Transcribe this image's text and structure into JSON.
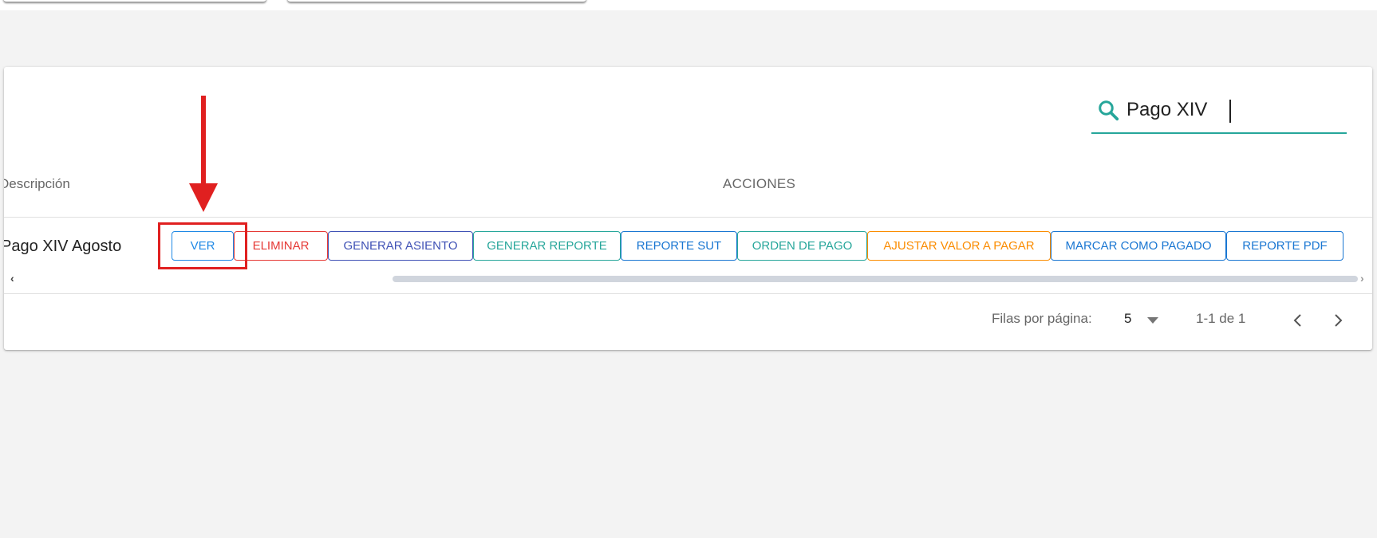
{
  "search": {
    "value": "Pago XIV",
    "icon": "search-icon"
  },
  "table": {
    "headers": {
      "description": "Descripción",
      "actions": "ACCIONES"
    },
    "rows": [
      {
        "description": "Pago XIV Agosto"
      }
    ]
  },
  "actions": [
    {
      "label": "VER",
      "color": "#1e88e5"
    },
    {
      "label": "ELIMINAR",
      "color": "#e53935"
    },
    {
      "label": "GENERAR ASIENTO",
      "color": "#3f51b5"
    },
    {
      "label": "GENERAR REPORTE",
      "color": "#26a69a"
    },
    {
      "label": "REPORTE SUT",
      "color": "#1976d2"
    },
    {
      "label": "ORDEN DE PAGO",
      "color": "#26a69a"
    },
    {
      "label": "AJUSTAR VALOR A PAGAR",
      "color": "#fb8c00"
    },
    {
      "label": "MARCAR COMO PAGADO",
      "color": "#1976d2"
    },
    {
      "label": "REPORTE PDF",
      "color": "#1976d2"
    }
  ],
  "pagination": {
    "rows_per_page_label": "Filas por página:",
    "rows_per_page_value": "5",
    "range": "1-1 de 1"
  },
  "colors": {
    "accent": "#26a69a",
    "annotation": "#e02020"
  }
}
